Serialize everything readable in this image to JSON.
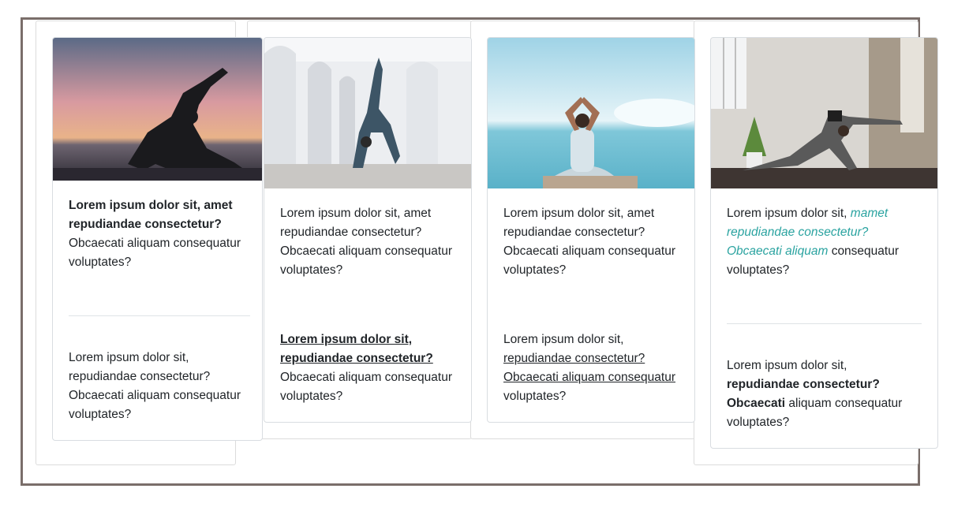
{
  "cards": [
    {
      "image_alt": "Yoga pose silhouette at sunset by the sea",
      "top": {
        "bold": "Lorem ipsum dolor sit, amet repudiandae consectetur?",
        "rest": "Obcaecati aliquam consequatur voluptates?"
      },
      "bottom": {
        "line1": "Lorem ipsum dolor sit,",
        "line2": "repudiandae consectetur?",
        "line3": "Obcaecati aliquam consequatur",
        "line4": "voluptates?"
      }
    },
    {
      "image_alt": "Backbend yoga pose in white arched hallway",
      "top": {
        "line1": "Lorem ipsum dolor sit, amet",
        "line2": "repudiandae consectetur?",
        "line3": "Obcaecati aliquam consequatur",
        "line4": "voluptates?"
      },
      "bottom": {
        "link1": "Lorem ipsum dolor sit,",
        "link2": "repudiandae consectetur?",
        "line3": "Obcaecati aliquam consequatur",
        "line4": "voluptates?"
      }
    },
    {
      "image_alt": "Meditation pose facing the ocean",
      "top": {
        "line1": "Lorem ipsum dolor sit, amet",
        "line2": "repudiandae consectetur?",
        "line3": "Obcaecati aliquam consequatur",
        "line4": "voluptates?"
      },
      "bottom": {
        "line1": "Lorem ipsum dolor sit,",
        "link2": "repudiandae consectetur?",
        "link3": "Obcaecati aliquam consequatur",
        "line4": "voluptates?"
      }
    },
    {
      "image_alt": "Yoga pose in a loft room with plant",
      "top": {
        "plain1": "Lorem ipsum dolor sit,",
        "em1": "mamet",
        "em2": "repudiandae consectetur?",
        "em3": "Obcaecati aliquam",
        "plain2": "consequatur",
        "line4": "voluptates?"
      },
      "bottom": {
        "line1": "Lorem ipsum dolor sit,",
        "bold2": "repudiandae consectetur?",
        "bold3": "Obcaecati",
        "plain3": "aliquam consequatur",
        "line4": "voluptates?"
      }
    }
  ],
  "colors": {
    "frame": "#7a6e6a",
    "accent": "#2aa3a0",
    "text": "#212529"
  }
}
